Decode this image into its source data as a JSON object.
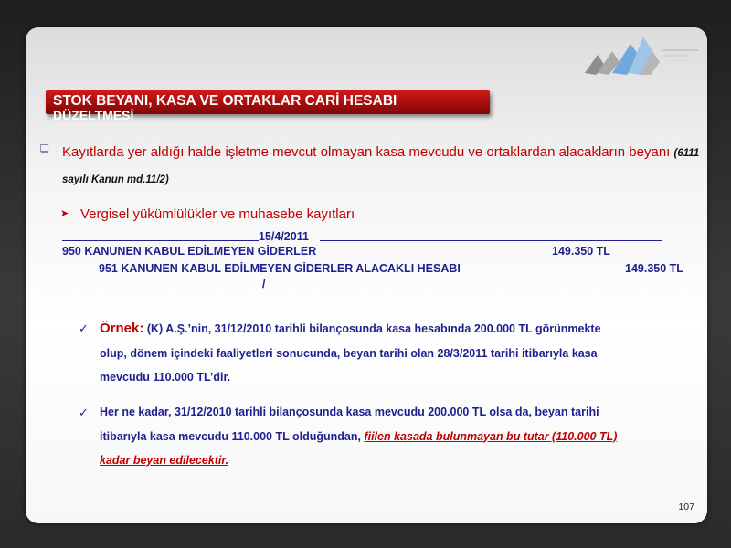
{
  "slide": {
    "title_line1": "STOK BEYANI, KASA VE ORTAKLAR CARİ HESABI",
    "title_line2": "DÜZELTMESİ",
    "bullet1": {
      "text": "Kayıtlarda yer aldığı halde işletme mevcut olmayan kasa mevcudu ve ortaklardan alacakların beyanı ",
      "ref": "(6111 sayılı Kanun md.11/2)"
    },
    "bullet2": "Vergisel yükümlülükler ve muhasebe kayıtları",
    "ledger": {
      "date": "15/4/2011",
      "debit_account": "950 KANUNEN KABUL EDİLMEYEN GİDERLER",
      "debit_amount": "149.350 TL",
      "credit_account": "951 KANUNEN KABUL EDİLMEYEN GİDERLER ALACAKLI HESABI",
      "credit_amount": "149.350 TL",
      "separator": "/"
    },
    "example1": {
      "lead": "Örnek:",
      "line1": " (K) A.Ş.’nin, 31/12/2010 tarihli bilançosunda kasa hesabında 200.000 TL görünmekte",
      "line2": "olup, dönem içindeki faaliyetleri sonucunda, beyan tarihi olan 28/3/2011 tarihi itibarıyla kasa",
      "line3": "mevcudu 110.000 TL’dir."
    },
    "example2": {
      "line1": "Her ne kadar, 31/12/2010 tarihli bilançosunda kasa mevcudu 200.000 TL olsa da, beyan tarihi",
      "line2_prefix": "itibarıyla kasa mevcudu 110.000 TL olduğundan, ",
      "line2_emph": "fiilen kasada bulunmayan bu tutar (110.000 TL)",
      "line3_emph": "kadar beyan edilecektir."
    },
    "page_number": "107"
  },
  "colors": {
    "accent_red": "#c00000",
    "text_blue": "#1f1f8f"
  },
  "icons": {
    "bullet1": "square-bullet-icon",
    "bullet2": "arrow-bullet-icon",
    "check": "check-mark-icon"
  }
}
